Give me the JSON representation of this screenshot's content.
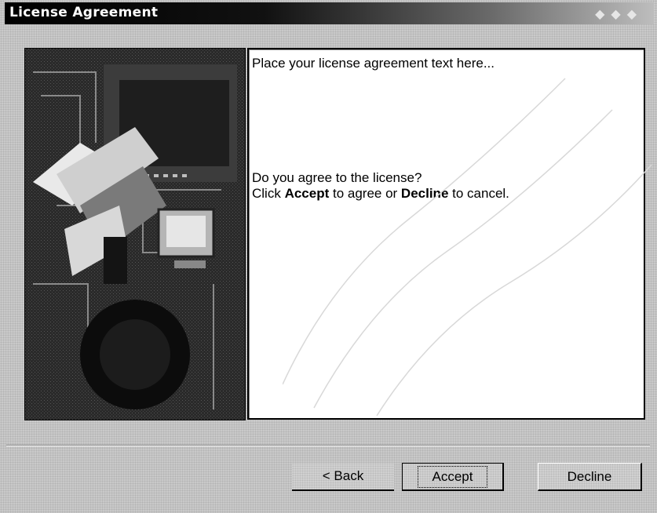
{
  "window": {
    "title": "License Agreement"
  },
  "license": {
    "placeholder_text": "Place your license agreement text here...",
    "question": "Do you agree to the license?",
    "instruction_prefix": "Click ",
    "accept_word": "Accept",
    "instruction_middle": " to agree or ",
    "decline_word": "Decline",
    "instruction_suffix": " to cancel."
  },
  "buttons": {
    "back": "< Back",
    "accept": "Accept",
    "decline": "Decline"
  },
  "colors": {
    "dialog_bg": "#c9c9c9",
    "titlebar": "#000000",
    "title_text": "#ffffff",
    "textbox_bg": "#ffffff"
  }
}
